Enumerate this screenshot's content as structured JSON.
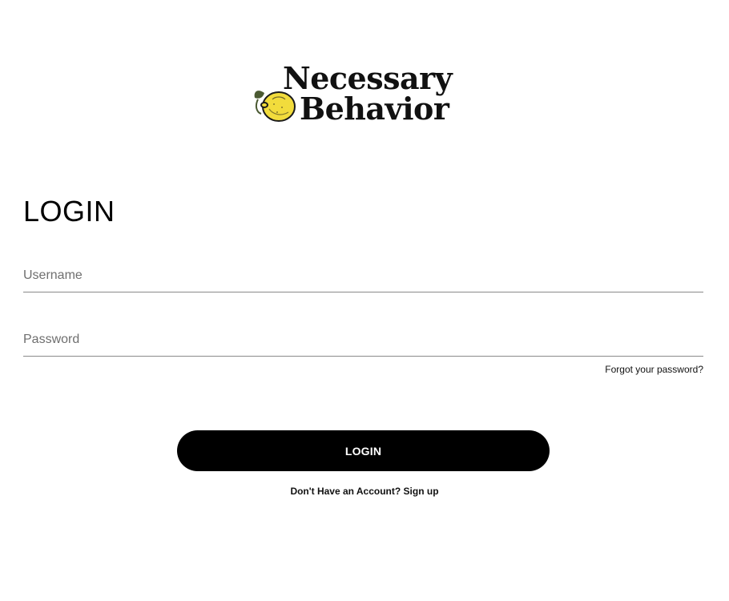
{
  "brand": {
    "line1": "Necessary",
    "line2": "Behavior",
    "emblem_icon": "lemon-icon",
    "colors": {
      "lemon": "#f2dc3c",
      "leaf": "#4b5a32",
      "text": "#111111"
    }
  },
  "login": {
    "heading": "LOGIN",
    "username_placeholder": "Username",
    "password_placeholder": "Password",
    "forgot_label": "Forgot your password?",
    "button_label": "LOGIN",
    "signup_prompt": "Don't Have an Account?",
    "signup_link": "Sign up"
  },
  "colors": {
    "background": "#ffffff",
    "button": "#000000",
    "button_text": "#ffffff",
    "underline": "#8a8a8a"
  }
}
